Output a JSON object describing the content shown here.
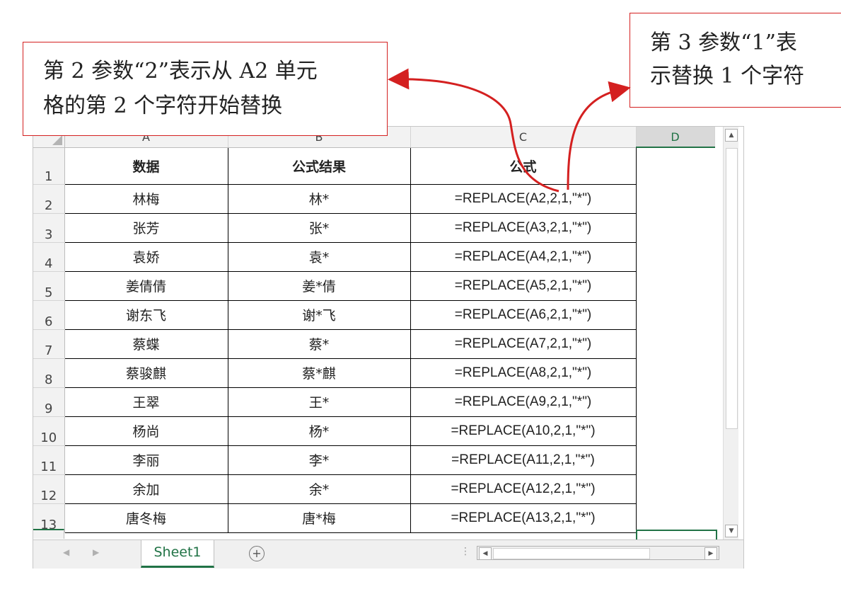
{
  "columns": [
    "A",
    "B",
    "C",
    "D"
  ],
  "row_numbers": [
    "1",
    "2",
    "3",
    "4",
    "5",
    "6",
    "7",
    "8",
    "9",
    "10",
    "11",
    "12",
    "13"
  ],
  "header_row": {
    "a": "数据",
    "b": "公式结果",
    "c": "公式"
  },
  "rows": [
    {
      "a": "林梅",
      "b": "林*",
      "c": "=REPLACE(A2,2,1,\"*\")"
    },
    {
      "a": "张芳",
      "b": "张*",
      "c": "=REPLACE(A3,2,1,\"*\")"
    },
    {
      "a": "袁娇",
      "b": "袁*",
      "c": "=REPLACE(A4,2,1,\"*\")"
    },
    {
      "a": "姜倩倩",
      "b": "姜*倩",
      "c": "=REPLACE(A5,2,1,\"*\")"
    },
    {
      "a": "谢东飞",
      "b": "谢*飞",
      "c": "=REPLACE(A6,2,1,\"*\")"
    },
    {
      "a": "蔡蝶",
      "b": "蔡*",
      "c": "=REPLACE(A7,2,1,\"*\")"
    },
    {
      "a": "蔡骏麒",
      "b": "蔡*麒",
      "c": "=REPLACE(A8,2,1,\"*\")"
    },
    {
      "a": "王翠",
      "b": "王*",
      "c": "=REPLACE(A9,2,1,\"*\")"
    },
    {
      "a": "杨尚",
      "b": "杨*",
      "c": "=REPLACE(A10,2,1,\"*\")"
    },
    {
      "a": "李丽",
      "b": "李*",
      "c": "=REPLACE(A11,2,1,\"*\")"
    },
    {
      "a": "余加",
      "b": "余*",
      "c": "=REPLACE(A12,2,1,\"*\")"
    },
    {
      "a": "唐冬梅",
      "b": "唐*梅",
      "c": "=REPLACE(A13,2,1,\"*\")"
    }
  ],
  "sheet_tab": "Sheet1",
  "callouts": {
    "left": {
      "line1": "第 2 参数“2”表示从 A2 单元",
      "line2": "格的第 2 个字符开始替换"
    },
    "right": {
      "line1": "第 3 参数“1”表",
      "line2": "示替换 1 个字符"
    }
  },
  "colors": {
    "accent_green": "#217346",
    "callout_red": "#d42020"
  },
  "icons": [
    "select-all-corner-icon",
    "scroll-up-icon",
    "scroll-down-icon",
    "scroll-left-icon",
    "scroll-right-icon",
    "add-sheet-icon",
    "prev-sheet-icon",
    "next-sheet-icon"
  ]
}
